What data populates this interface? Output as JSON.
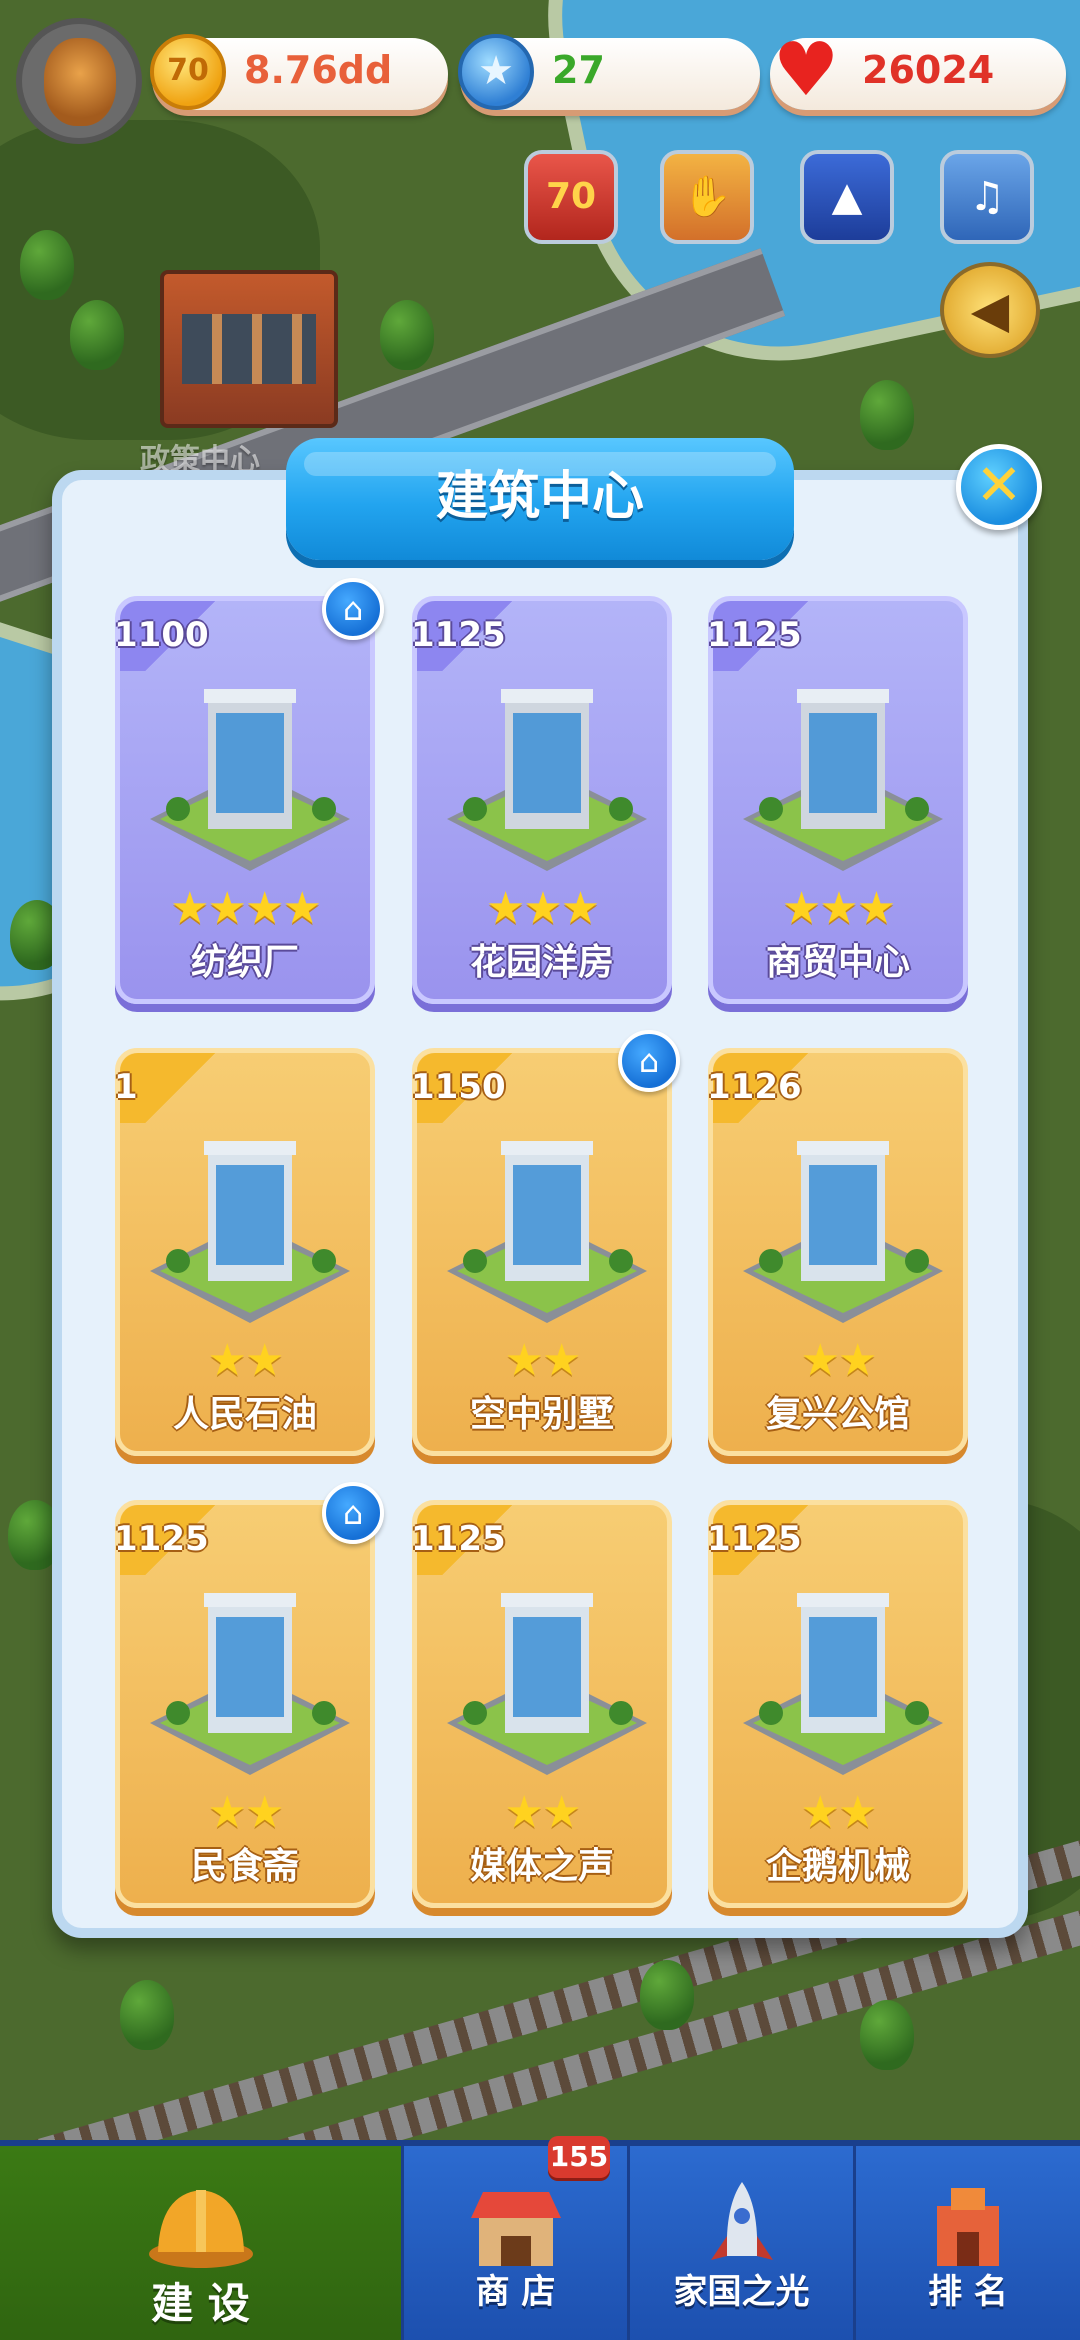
{
  "map": {
    "location_label": "政策中心"
  },
  "hud": {
    "resources": [
      {
        "icon": "coin-icon",
        "value": "8.76dd",
        "icon_text": "70"
      },
      {
        "icon": "star-gem-icon",
        "value": "27"
      },
      {
        "icon": "heart-icon",
        "value": "26024"
      }
    ],
    "event_badge_text": "70"
  },
  "dialog": {
    "title": "建筑中心",
    "close_icon": "close-icon"
  },
  "buildings": [
    {
      "cost": "1100",
      "stars": "★★★★",
      "name": "纺织厂",
      "theme": "purple",
      "home_badge": true
    },
    {
      "cost": "1125",
      "stars": "★★★",
      "name": "花园洋房",
      "theme": "purple",
      "home_badge": false
    },
    {
      "cost": "1125",
      "stars": "★★★",
      "name": "商贸中心",
      "theme": "purple",
      "home_badge": false
    },
    {
      "cost": "1",
      "stars": "★★",
      "name": "人民石油",
      "theme": "orange",
      "home_badge": false
    },
    {
      "cost": "1150",
      "stars": "★★",
      "name": "空中别墅",
      "theme": "orange",
      "home_badge": true
    },
    {
      "cost": "1126",
      "stars": "★★",
      "name": "复兴公馆",
      "theme": "orange",
      "home_badge": false
    },
    {
      "cost": "1125",
      "stars": "★★",
      "name": "民食斋",
      "theme": "orange",
      "home_badge": true
    },
    {
      "cost": "1125",
      "stars": "★★",
      "name": "媒体之声",
      "theme": "orange",
      "home_badge": false
    },
    {
      "cost": "1125",
      "stars": "★★",
      "name": "企鹅机械",
      "theme": "orange",
      "home_badge": false
    }
  ],
  "bottom_nav": {
    "items": [
      {
        "label": "建 设",
        "icon": "hard-hat-icon"
      },
      {
        "label": "商 店",
        "icon": "shop-icon"
      },
      {
        "label": "家国之光",
        "icon": "rocket-icon"
      },
      {
        "label": "排 名",
        "icon": "trophy-building-icon"
      }
    ],
    "shop_badge": "155"
  },
  "colors": {
    "dialog_bg": "#e6f1fb",
    "title_blue": "#22a4ef",
    "card_purple": "#9a93ee",
    "card_orange": "#eeb04d",
    "coin_text": "#e8603a",
    "gem_text": "#3aa829",
    "heart_text": "#e03228"
  }
}
